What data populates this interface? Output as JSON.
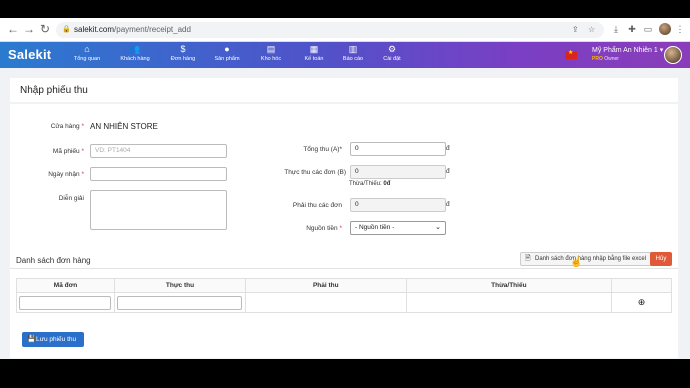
{
  "browser": {
    "url_host": "salekit.com",
    "url_path": "/payment/receipt_add"
  },
  "header": {
    "logo": "Salekit",
    "menu": [
      {
        "label": "Tổng quan",
        "icon": "home-icon"
      },
      {
        "label": "Khách hàng",
        "icon": "users-icon"
      },
      {
        "label": "Đơn hàng",
        "icon": "dollar-icon"
      },
      {
        "label": "Sản phẩm",
        "icon": "product-icon"
      },
      {
        "label": "Kho hóc",
        "icon": "warehouse-icon"
      },
      {
        "label": "Kế toán",
        "icon": "accounting-icon"
      },
      {
        "label": "Báo cáo",
        "icon": "chart-icon"
      },
      {
        "label": "Cài đặt",
        "icon": "gear-icon"
      }
    ],
    "user_name": "Mỹ Phẩm An Nhiên 1",
    "user_role": "Owner",
    "role_badge": "PRO"
  },
  "page": {
    "title": "Nhập phiếu thu"
  },
  "form": {
    "store_label": "Cửa hàng",
    "store_value": "AN NHIÊN STORE",
    "receipt_code_label": "Mã phiếu",
    "receipt_code_placeholder": "VD: PT1404",
    "date_label": "Ngày nhận",
    "note_label": "Diễn giải",
    "total_label": "Tổng thu (A)*",
    "total_value": "0",
    "actual_label": "Thực thu các đơn (B)",
    "actual_value": "0",
    "diff_label": "Thừa/Thiếu:",
    "diff_value": "0đ",
    "due_label": "Phải thu các đơn",
    "due_value": "0",
    "currency": "đ",
    "source_label": "Nguồn tiền",
    "source_selected": "- Nguồn tiền -"
  },
  "orders": {
    "section_title": "Danh sách đơn hàng",
    "excel_button": "Danh sách đơn hàng nhập bằng file excel",
    "cancel_button": "Hủy",
    "columns": [
      "Mã đơn",
      "Thực thu",
      "Phải thu",
      "Thừa/Thiếu"
    ]
  },
  "save_button": "Lưu phiếu thu"
}
